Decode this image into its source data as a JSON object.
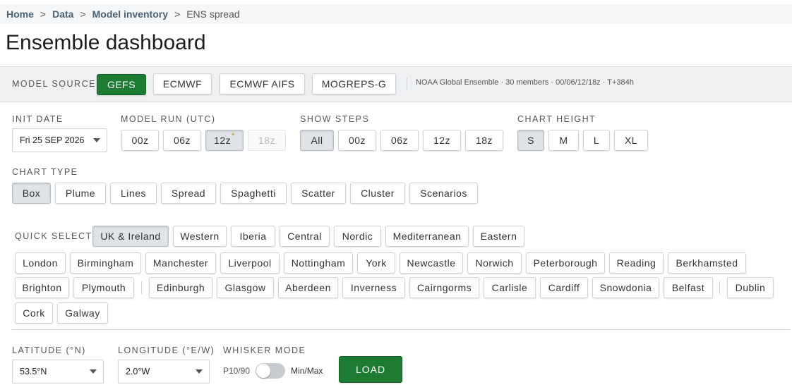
{
  "breadcrumb": {
    "items": [
      "Home",
      "Data",
      "Model inventory"
    ],
    "separator": ">",
    "current": "ENS spread"
  },
  "page": {
    "title": "Ensemble dashboard"
  },
  "model_source": {
    "label": "MODEL SOURCE",
    "options": [
      "GEFS",
      "ECMWF",
      "ECMWF AIFS",
      "MOGREPS-G"
    ],
    "selected": "GEFS",
    "info": "NOAA Global Ensemble · 30 members · 00/06/12/18z · T+384h"
  },
  "init_date": {
    "label": "INIT DATE",
    "value": "Fri 25 SEP 2026"
  },
  "model_run": {
    "label": "MODEL RUN (UTC)",
    "options": [
      "00z",
      "06z",
      "12z",
      "18z"
    ],
    "selected": "12z",
    "starred": "12z",
    "disabled": "18z",
    "star": "*"
  },
  "show_steps": {
    "label": "SHOW STEPS",
    "options": [
      "All",
      "00z",
      "06z",
      "12z",
      "18z"
    ],
    "selected": "All"
  },
  "chart_height": {
    "label": "CHART HEIGHT",
    "options": [
      "S",
      "M",
      "L",
      "XL"
    ],
    "selected": "S"
  },
  "chart_type": {
    "label": "CHART TYPE",
    "options": [
      "Box",
      "Plume",
      "Lines",
      "Spread",
      "Spaghetti",
      "Scatter",
      "Cluster",
      "Scenarios"
    ],
    "selected": "Box"
  },
  "quick_select": {
    "label": "QUICK SELECT",
    "regions": [
      "UK & Ireland",
      "Western",
      "Iberia",
      "Central",
      "Nordic",
      "Mediterranean",
      "Eastern"
    ],
    "selected_region": "UK & Ireland",
    "england": [
      "London",
      "Birmingham",
      "Manchester",
      "Liverpool",
      "Nottingham",
      "York",
      "Newcastle",
      "Norwich",
      "Peterborough",
      "Reading",
      "Berkhamsted",
      "Brighton",
      "Plymouth"
    ],
    "scotland_wales_ni": [
      "Edinburgh",
      "Glasgow",
      "Aberdeen",
      "Inverness",
      "Cairngorms",
      "Carlisle",
      "Cardiff",
      "Snowdonia",
      "Belfast"
    ],
    "ireland": [
      "Dublin",
      "Cork",
      "Galway"
    ]
  },
  "latitude": {
    "label": "LATITUDE (°N)",
    "value": "53.5°N"
  },
  "longitude": {
    "label": "LONGITUDE (°E/W)",
    "value": "2.0°W"
  },
  "whisker_mode": {
    "label": "WHISKER MODE",
    "left": "P10/90",
    "right": "Min/Max",
    "on": false
  },
  "load_label": "LOAD",
  "colors": {
    "accent_green": "#1e7b33",
    "active_grey": "#dfe2e6",
    "bar_bg": "#eef0f2",
    "star": "#c4961b"
  }
}
